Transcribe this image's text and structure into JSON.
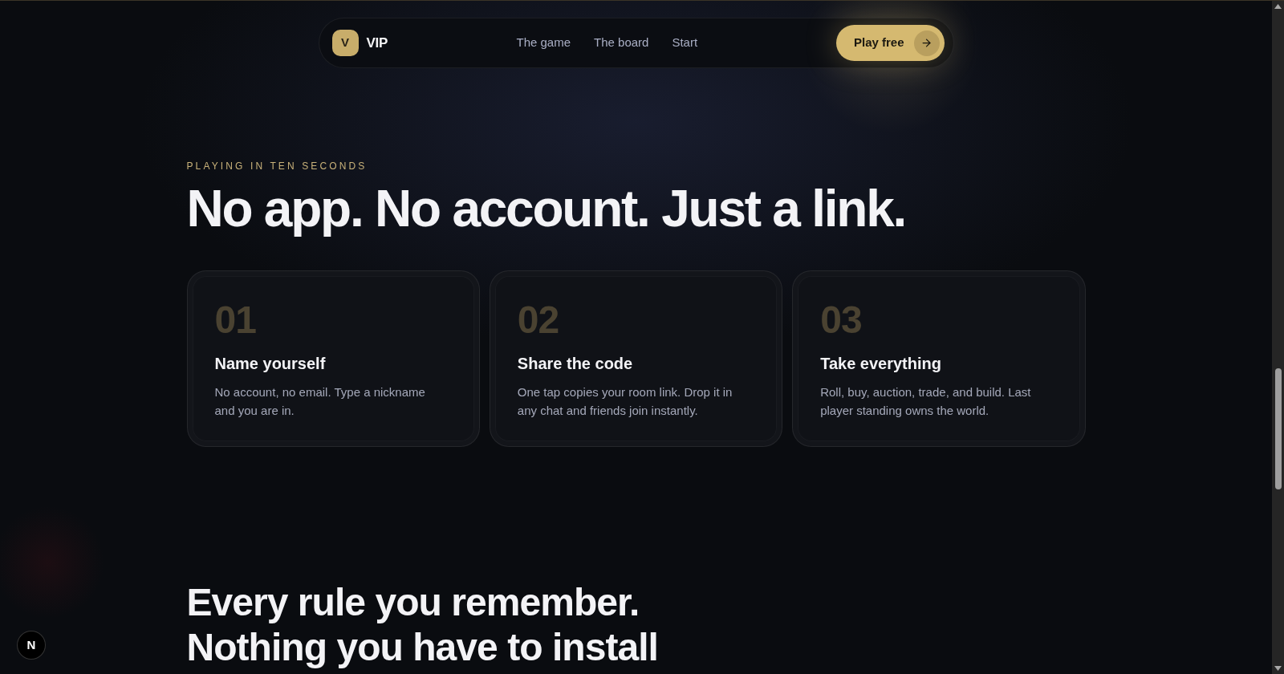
{
  "nav": {
    "logo": {
      "mark": "V",
      "name": "VIP"
    },
    "links": [
      "The game",
      "The board",
      "Start"
    ],
    "cta": {
      "label": "Play free"
    }
  },
  "hero": {
    "eyebrow": "PLAYING IN TEN SECONDS",
    "heading": "No app. No account. Just a link.",
    "steps": [
      {
        "number": "01",
        "title": "Name yourself",
        "text": "No account, no email. Type a nickname and you are in."
      },
      {
        "number": "02",
        "title": "Share the code",
        "text": "One tap copies your room link. Drop it in any chat and friends join instantly."
      },
      {
        "number": "03",
        "title": "Take everything",
        "text": "Roll, buy, auction, trade, and build. Last player standing owns the world."
      }
    ]
  },
  "features": {
    "heading_lines": [
      "Every rule you remember.",
      "Nothing you have to install"
    ]
  },
  "dev_badge": {
    "label": "N"
  }
}
